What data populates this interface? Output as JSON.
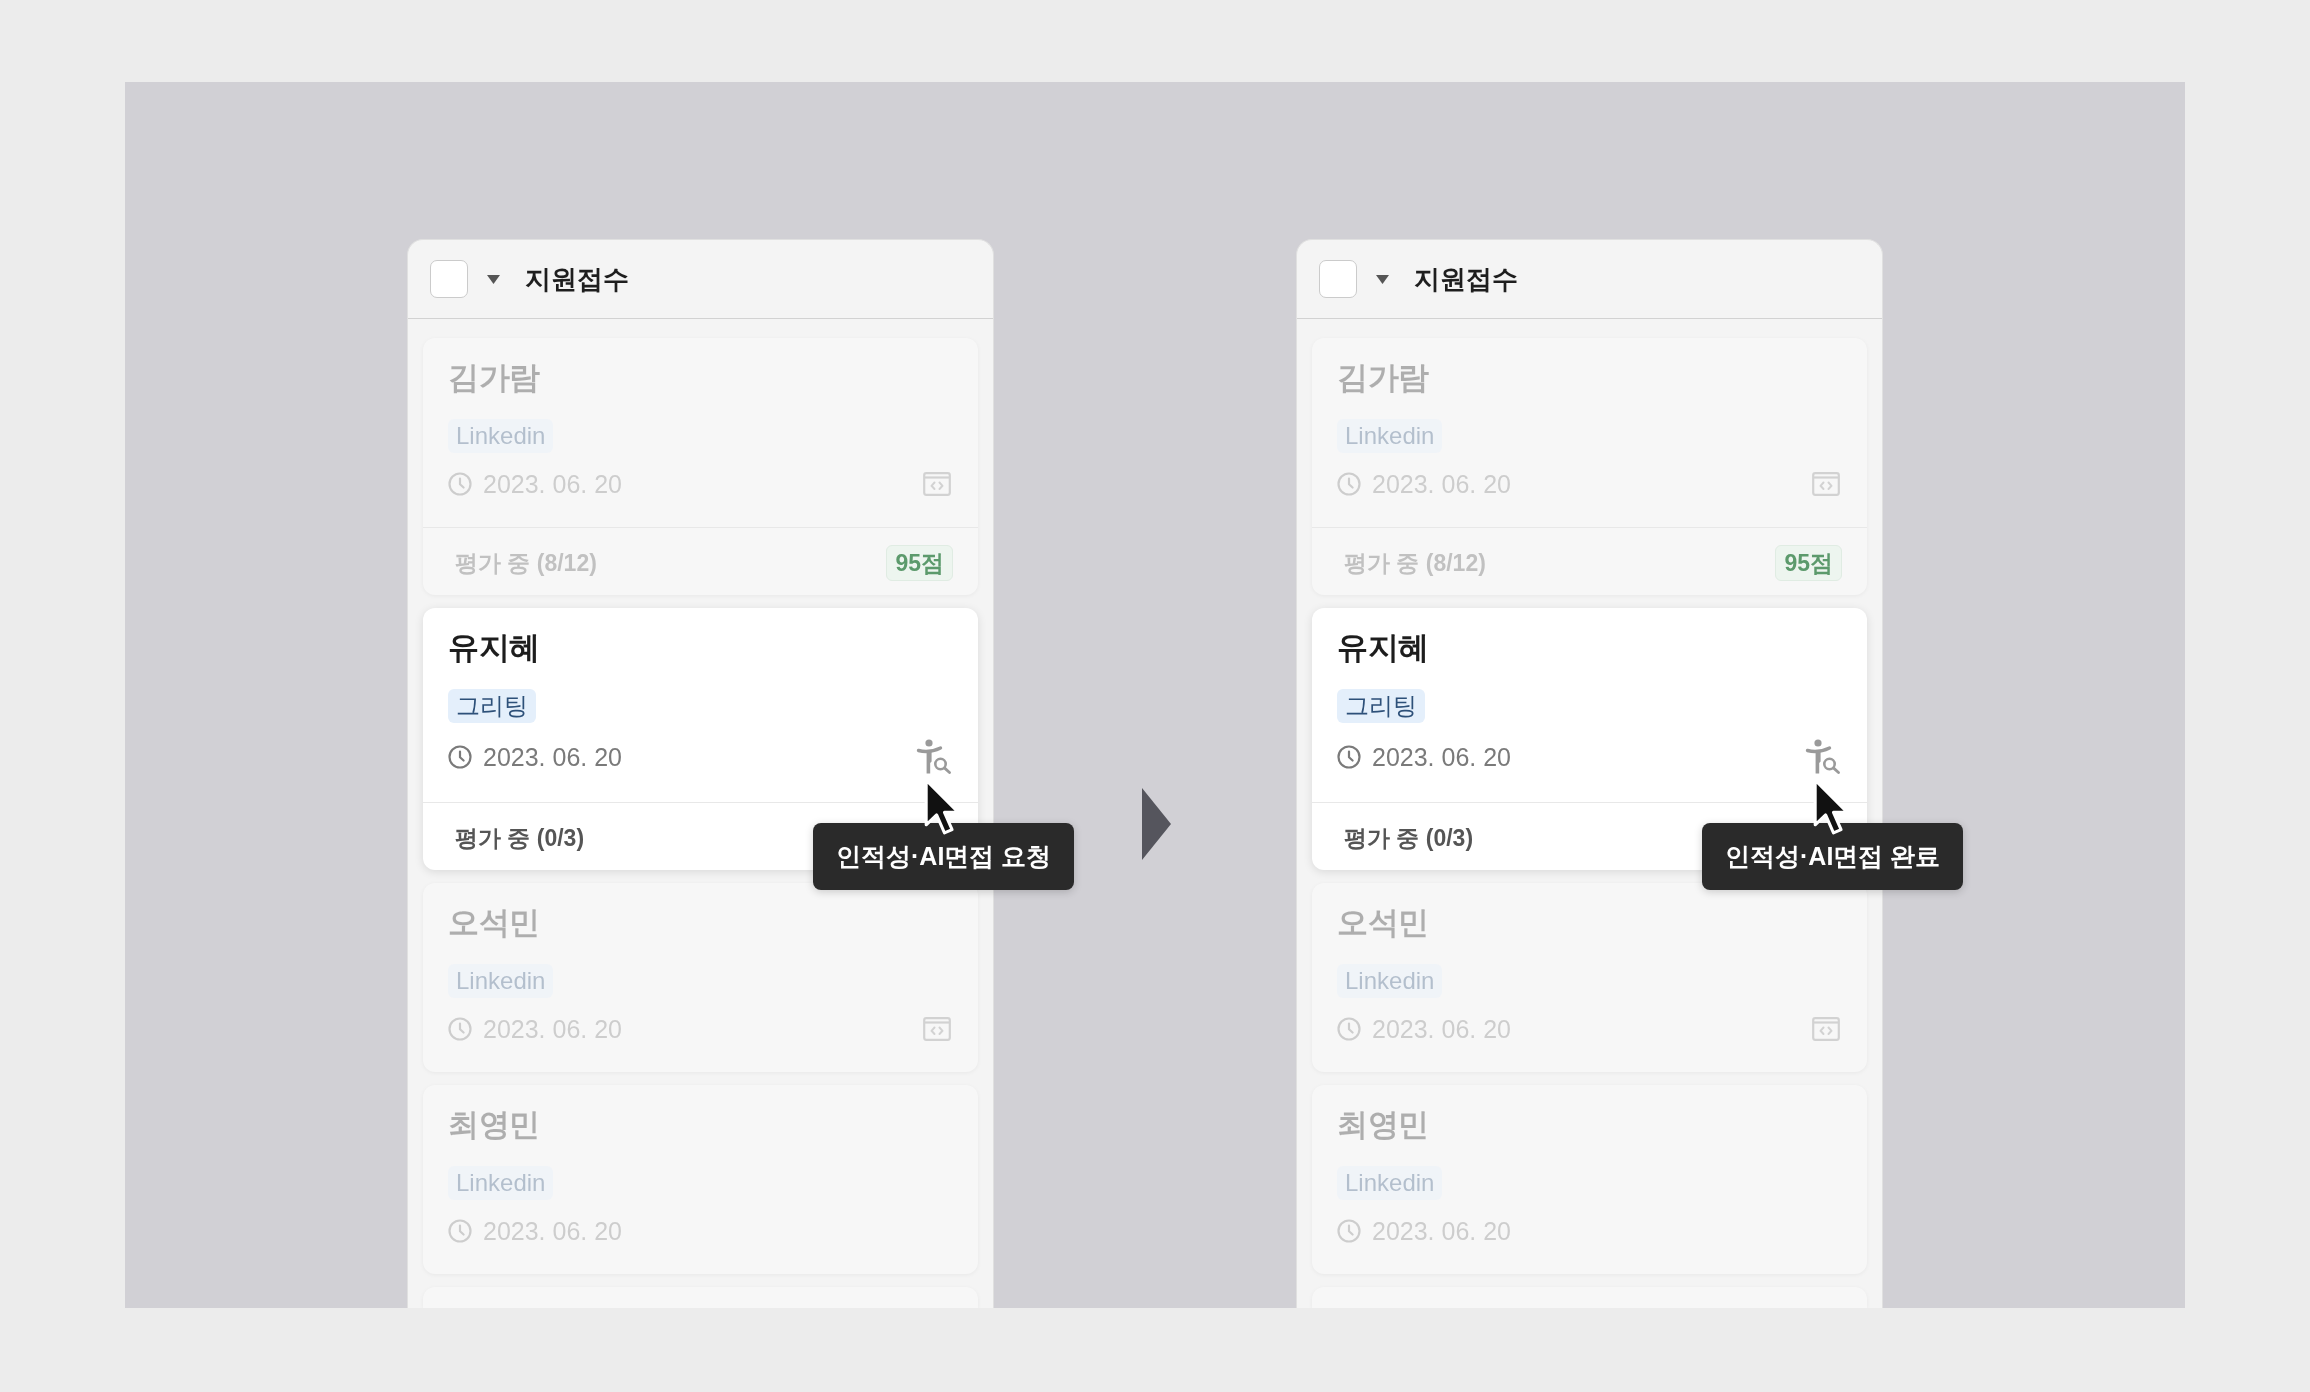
{
  "panels": [
    {
      "header": {
        "checked": false,
        "title": "지원접수"
      },
      "cards": [
        {
          "kind": "applicant",
          "name": "김가람",
          "tag": "Linkedin",
          "date": "2023. 06. 20",
          "action_icon": true,
          "status": "평가 중 (8/12)",
          "score": "95점",
          "selected": false
        },
        {
          "kind": "applicant",
          "name": "유지혜",
          "tag": "그리팅",
          "date": "2023. 06. 20",
          "action_icon": true,
          "status": "평가 중 (0/3)",
          "tooltip": "인적성·AI면접 요청",
          "selected": true
        },
        {
          "kind": "applicant",
          "name": "오석민",
          "tag": "Linkedin",
          "date": "2023. 06. 20",
          "action_icon": true,
          "selected": false
        },
        {
          "kind": "applicant",
          "name": "최영민",
          "tag": "Linkedin",
          "date": "2023. 06. 20",
          "action_icon": false,
          "selected": false
        },
        {
          "kind": "cut_off"
        }
      ]
    },
    {
      "header": {
        "checked": false,
        "title": "지원접수"
      },
      "cards": [
        {
          "kind": "applicant",
          "name": "김가람",
          "tag": "Linkedin",
          "date": "2023. 06. 20",
          "action_icon": true,
          "status": "평가 중 (8/12)",
          "score": "95점",
          "selected": false
        },
        {
          "kind": "applicant",
          "name": "유지혜",
          "tag": "그리팅",
          "date": "2023. 06. 20",
          "action_icon": true,
          "status": "평가 중 (0/3)",
          "tooltip": "인적성·AI면접 완료",
          "selected": true
        },
        {
          "kind": "applicant",
          "name": "오석민",
          "tag": "Linkedin",
          "date": "2023. 06. 20",
          "action_icon": true,
          "selected": false
        },
        {
          "kind": "applicant",
          "name": "최영민",
          "tag": "Linkedin",
          "date": "2023. 06. 20",
          "action_icon": false,
          "selected": false
        },
        {
          "kind": "cut_off"
        }
      ]
    }
  ]
}
